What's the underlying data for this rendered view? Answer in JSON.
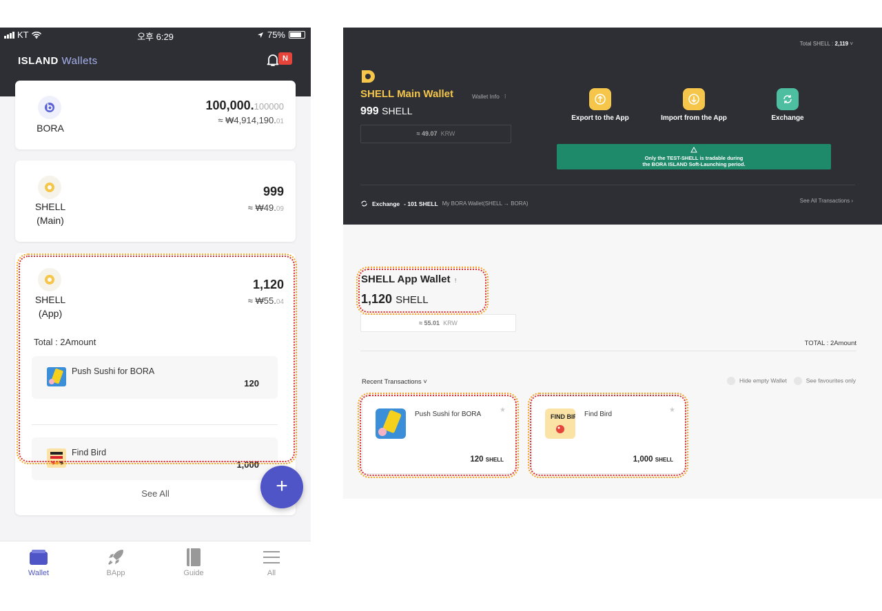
{
  "mobile": {
    "status": {
      "carrier": "KT",
      "time": "오후 6:29",
      "battery": "75%"
    },
    "brand": "ISLAND",
    "brand_accent": "Wallets",
    "notification_badge": "N",
    "bora": {
      "name": "BORA",
      "amount_int": "100,000.",
      "amount_dec": "100000",
      "krw_int": "≈ ₩4,914,190.",
      "krw_dec": "01"
    },
    "shell_main": {
      "name1": "SHELL",
      "name2": "(Main)",
      "amount_int": "999",
      "krw_int": "≈ ₩49.",
      "krw_dec": "09"
    },
    "shell_app": {
      "name1": "SHELL",
      "name2": "(App)",
      "amount_int": "1,120",
      "krw_int": "≈ ₩55.",
      "krw_dec": "04",
      "total": "Total : 2Amount",
      "apps": [
        {
          "name": "Push Sushi for BORA",
          "value": "120"
        },
        {
          "name": "Find Bird",
          "value": "1,000"
        }
      ]
    },
    "see_all": "See All",
    "fab_label": "+",
    "tabs": [
      {
        "label": "Wallet"
      },
      {
        "label": "BApp"
      },
      {
        "label": "Guide"
      },
      {
        "label": "All"
      }
    ]
  },
  "desktop": {
    "total_shell_label": "Total SHELL :",
    "total_shell_value": "2,119",
    "main_wallet": {
      "title": "SHELL Main Wallet",
      "info": "Wallet Info",
      "balance": "999",
      "unit": "SHELL",
      "krw_int": "≈ 49.",
      "krw_dec": "07",
      "krw_unit": "KRW"
    },
    "actions": [
      {
        "label": "Export to the App"
      },
      {
        "label": "Import from the App"
      },
      {
        "label": "Exchange"
      }
    ],
    "notice_line1": "Only the TEST-SHELL is tradable during",
    "notice_line2": "the BORA ISLAND Soft-Launching period.",
    "recent_exchange": {
      "label": "Exchange",
      "amount": "- 101 SHELL",
      "detail": "My BORA Wallet(SHELL → BORA)"
    },
    "see_all": "See All Transactions",
    "app_wallet": {
      "title": "SHELL App Wallet",
      "info": "!",
      "balance": "1,120",
      "unit": "SHELL",
      "krw_int": "≈ 55.",
      "krw_dec": "01",
      "krw_unit": "KRW"
    },
    "total_amount": "TOTAL : 2Amount",
    "recent_transactions": "Recent Transactions",
    "hide_empty": "Hide empty Wallet",
    "favourites_only": "See favourites only",
    "apps": [
      {
        "name": "Push Sushi for BORA",
        "value": "120",
        "unit": "SHELL"
      },
      {
        "name": "Find Bird",
        "value": "1,000",
        "unit": "SHELL"
      }
    ],
    "find_bird_logo_text": "FIND BIRD"
  },
  "colors": {
    "dark": "#2d2f35",
    "accent": "#4f55c6",
    "shell_gold": "#f5c64a",
    "notice_green": "#1f8a6a",
    "badge_red": "#e6433b"
  }
}
